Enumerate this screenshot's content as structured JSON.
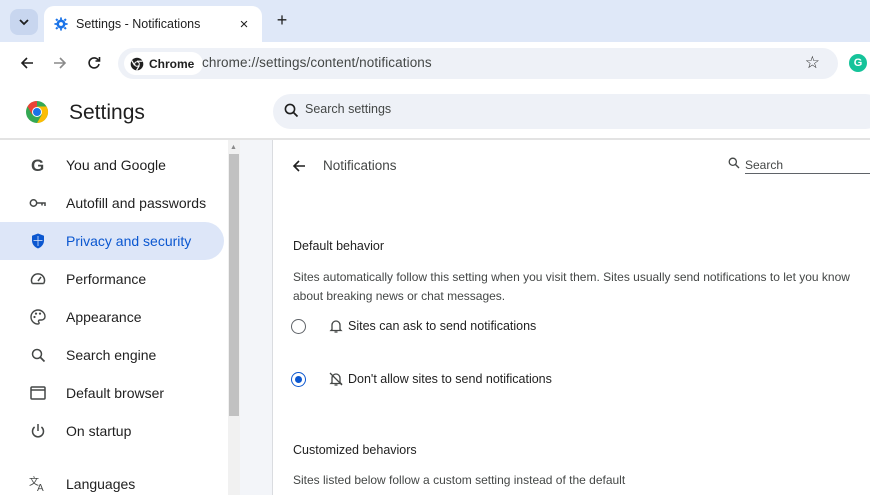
{
  "tab": {
    "title": "Settings - Notifications",
    "close_glyph": "×",
    "new_tab_glyph": "+"
  },
  "toolbar": {
    "chip_label": "Chrome",
    "url": "chrome://settings/content/notifications",
    "bookmark_glyph": "☆",
    "extension_glyph": "G"
  },
  "header": {
    "title": "Settings",
    "search_placeholder": "Search settings"
  },
  "sidebar": {
    "items": [
      {
        "label": "You and Google",
        "icon": "google-g-icon"
      },
      {
        "label": "Autofill and passwords",
        "icon": "key-icon"
      },
      {
        "label": "Privacy and security",
        "icon": "shield-icon",
        "active": true
      },
      {
        "label": "Performance",
        "icon": "gauge-icon"
      },
      {
        "label": "Appearance",
        "icon": "palette-icon"
      },
      {
        "label": "Search engine",
        "icon": "search-icon"
      },
      {
        "label": "Default browser",
        "icon": "browser-window-icon"
      },
      {
        "label": "On startup",
        "icon": "power-icon"
      },
      {
        "label": "Languages",
        "icon": "translate-icon"
      }
    ]
  },
  "main": {
    "page_title": "Notifications",
    "search_placeholder": "Search",
    "default_behavior": {
      "heading": "Default behavior",
      "description": "Sites automatically follow this setting when you visit them. Sites usually send notifications to let you know about breaking news or chat messages.",
      "options": [
        {
          "label": "Sites can ask to send notifications",
          "icon": "bell-icon",
          "checked": false
        },
        {
          "label": "Don't allow sites to send notifications",
          "icon": "bell-off-icon",
          "checked": true
        }
      ]
    },
    "customized_behaviors": {
      "heading": "Customized behaviors",
      "description": "Sites listed below follow a custom setting instead of the default"
    }
  },
  "colors": {
    "accent": "#0b57d0",
    "active_nav_bg": "#dde6f8",
    "tabstrip_bg": "#dfe8f8"
  }
}
